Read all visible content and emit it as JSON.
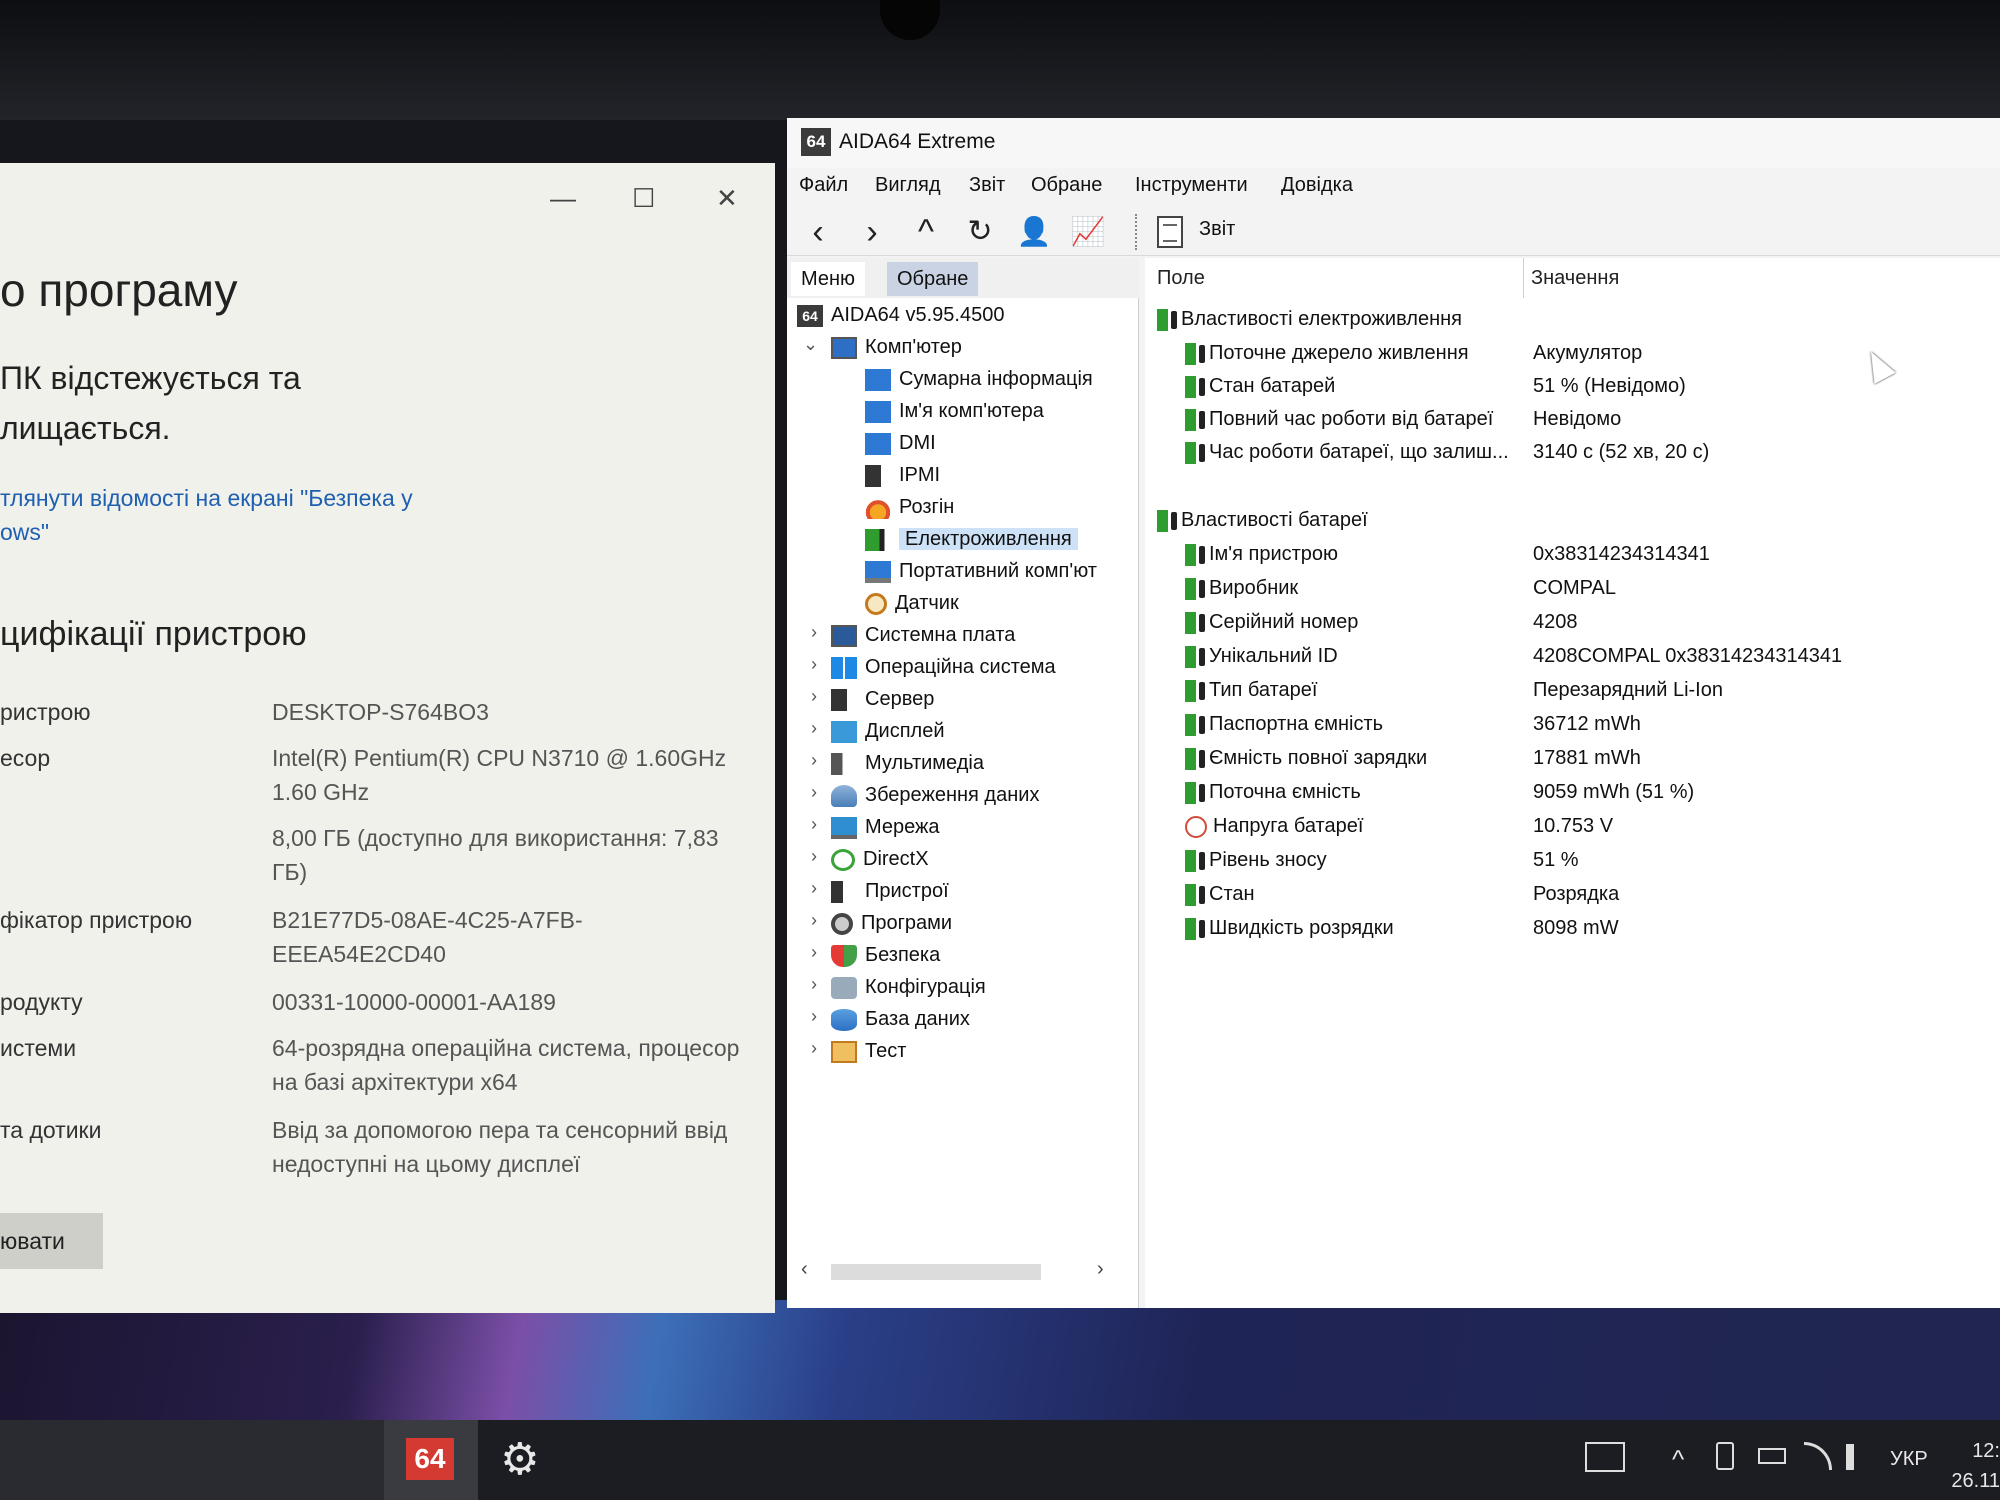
{
  "settings": {
    "min": "—",
    "max": "☐",
    "close": "✕",
    "title": "о програму",
    "protect_line1": "ПК відстежується та",
    "protect_line2": "лищається.",
    "link_line1": "тлянути відомості на екрані \"Безпека у",
    "link_line2": "ows\"",
    "spec_heading": "цифікації пристрою",
    "specs": [
      {
        "key": "ристрою",
        "value": "DESKTOP-S764BO3"
      },
      {
        "key": "есор",
        "value": "Intel(R) Pentium(R) CPU  N3710  @ 1.60GHz   1.60 GHz"
      },
      {
        "key": "",
        "value": "8,00 ГБ (доступно для використання: 7,83 ГБ)"
      },
      {
        "key": "фікатор пристрою",
        "value": "B21E77D5-08AE-4C25-A7FB-EEEA54E2CD40"
      },
      {
        "key": "родукту",
        "value": "00331-10000-00001-AA189"
      },
      {
        "key": "истеми",
        "value": "64-розрядна операційна система, процесор на базі архітектури x64"
      },
      {
        "key": "та дотики",
        "value": "Ввід за допомогою пера та сенсорний ввід недоступні на цьому дисплеї"
      }
    ],
    "rename_button": "ювати"
  },
  "aida": {
    "app_icon": "64",
    "title": "AIDA64 Extreme",
    "menu": [
      "Файл",
      "Вигляд",
      "Звіт",
      "Обране",
      "Інструменти",
      "Довідка"
    ],
    "toolbar": {
      "back": "‹",
      "forward": "›",
      "up": "^",
      "refresh": "↻",
      "user": "👤",
      "chart": "📈",
      "report_label": "Звіт"
    },
    "tabs": {
      "menu": "Меню",
      "favorites": "Обране"
    },
    "tree": {
      "root": "AIDA64 v5.95.4500",
      "computer": "Комп'ютер",
      "computer_children": [
        "Сумарна інформація",
        "Ім'я комп'ютера",
        "DMI",
        "IPMI",
        "Розгін",
        "Електроживлення",
        "Портативний комп'ют",
        "Датчик"
      ],
      "sections": [
        "Системна плата",
        "Операційна система",
        "Сервер",
        "Дисплей",
        "Мультимедіа",
        "Збереження даних",
        "Мережа",
        "DirectX",
        "Пристрої",
        "Програми",
        "Безпека",
        "Конфігурація",
        "База даних",
        "Тест"
      ],
      "scroll_left": "‹",
      "scroll_right": "›"
    },
    "columns": {
      "field": "Поле",
      "value": "Значення"
    },
    "power_group": "Властивості електроживлення",
    "power_rows": [
      {
        "field": "Поточне джерело живлення",
        "value": "Акумулятор"
      },
      {
        "field": "Стан батарей",
        "value": "51 % (Невідомо)"
      },
      {
        "field": "Повний час роботи від батареї",
        "value": "Невідомо"
      },
      {
        "field": "Час роботи батареї, що залиш...",
        "value": "3140 с (52 хв, 20 с)"
      }
    ],
    "battery_group": "Властивості батареї",
    "battery_rows": [
      {
        "field": "Ім'я пристрою",
        "value": "0x38314234314341"
      },
      {
        "field": "Виробник",
        "value": "COMPAL"
      },
      {
        "field": "Серійний номер",
        "value": "4208"
      },
      {
        "field": "Унікальний ID",
        "value": "4208COMPAL 0x38314234314341"
      },
      {
        "field": "Тип батареї",
        "value": "Перезарядний Li-Ion"
      },
      {
        "field": "Паспортна ємність",
        "value": "36712 mWh"
      },
      {
        "field": "Ємність повної зарядки",
        "value": "17881 mWh"
      },
      {
        "field": "Поточна ємність",
        "value": "9059 mWh  (51 %)"
      },
      {
        "field": "Напруга батареї",
        "value": "10.753 V"
      },
      {
        "field": "Рівень зносу",
        "value": "51 %"
      },
      {
        "field": "Стан",
        "value": "Розрядка"
      },
      {
        "field": "Швидкість розрядки",
        "value": "8098 mW"
      }
    ]
  },
  "taskbar": {
    "aida_badge": "64",
    "gear": "⚙",
    "tray_up": "^",
    "lang": "УКР",
    "time": "12:",
    "date": "26.11"
  }
}
